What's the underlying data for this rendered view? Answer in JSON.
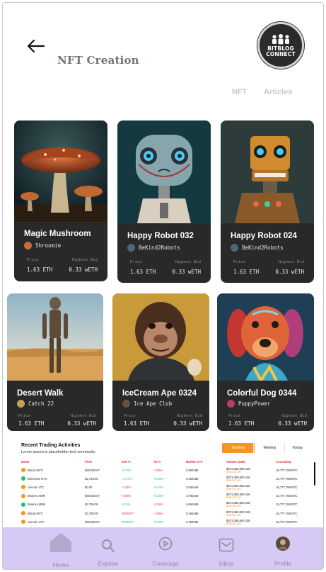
{
  "header": {
    "title": "NFT Creation",
    "logo_line1": "BITBLOG",
    "logo_line2": "CONNECT",
    "tabs": [
      "NFT",
      "Articles"
    ]
  },
  "cards": [
    {
      "title": "Magic Mushroom",
      "creator": "Shroomie",
      "price_label": "Price",
      "bid_label": "Highest Bid",
      "price": "1.63 ETH",
      "bid": "0.33 wETH"
    },
    {
      "title": "Happy Robot 032",
      "creator": "BeKind2Robots",
      "price_label": "Price",
      "bid_label": "Highest Bid",
      "price": "1.63 ETH",
      "bid": "0.33 wETH"
    },
    {
      "title": "Happy Robot 024",
      "creator": "BeKind2Robots",
      "price_label": "Price",
      "bid_label": "Highest Bid",
      "price": "1.63 ETH",
      "bid": "0.33 wETH"
    },
    {
      "title": "Desert Walk",
      "creator": "Catch 22",
      "price_label": "Price",
      "bid_label": "Highest Bid",
      "price": "1.63 ETH",
      "bid": "0.33 wETH"
    },
    {
      "title": "IceCream Ape 0324",
      "creator": "Ice Ape Club",
      "price_label": "Price",
      "bid_label": "Highest Bid",
      "price": "1.63 ETH",
      "bid": "0.33 wETH"
    },
    {
      "title": "Colorful Dog 0344",
      "creator": "PuppyPower",
      "price_label": "Price",
      "bid_label": "Highest Bid",
      "price": "1.63 ETH",
      "bid": "0.33 wETH"
    }
  ],
  "trading": {
    "title": "Recent Trading Activities",
    "subtitle": "Lorem ipsum is placeholder text commonly.",
    "periods": [
      "Monthly",
      "Weekly",
      "Today"
    ],
    "columns": [
      "Name",
      "Price",
      "24H %",
      "7D %",
      "Market CAP",
      "Volume (24H)",
      "Circulating"
    ],
    "rows": [
      {
        "coin": "Bitcoin BTC",
        "price": "$40,500.07",
        "h24": "+0.93%",
        "d7": "-4.55%",
        "cap": "0.854468",
        "vol": "$373,359,590,155",
        "vol2": "$950,520,600",
        "circ": "18,777,768 BTC"
      },
      {
        "coin": "Ethereum ETH",
        "price": "$2,799.00",
        "h24": "+4.47%",
        "d7": "+8.49%",
        "cap": "0.454468",
        "vol": "$373,359,590,155",
        "vol2": "$950,520,600",
        "circ": "18,777,768 BTC"
      },
      {
        "coin": "Litecoin LTC",
        "price": "$0.00",
        "h24": "-3.32%",
        "d7": "+0.04%",
        "cap": "23.65446",
        "vol": "$373,359,590,155",
        "vol2": "$950,520,600",
        "circ": "18,777,768 BTC"
      },
      {
        "coin": "Monero XMR",
        "price": "$40,500.07",
        "h24": "-0.93%",
        "d7": "+4.55%",
        "cap": "17.65446",
        "vol": "$373,359,590,155",
        "vol2": "$950,520,600",
        "circ": "18,777,768 BTC"
      },
      {
        "coin": "Binance BNB",
        "price": "$2,799.00",
        "h24": "+0.0%",
        "d7": "-0.02%",
        "cap": "0.654468",
        "vol": "$373,359,590,155",
        "vol2": "$950,520,600",
        "circ": "18,777,768 BTC"
      },
      {
        "coin": "Bitcoin BTC",
        "price": "$2,799.00",
        "h24": "MARKET",
        "d7": "-4.55%",
        "cap": "0.454468",
        "vol": "$373,359,590,155",
        "vol2": "$950,520,600",
        "circ": "18,777,768 BTC"
      },
      {
        "coin": "Litecoin LTC",
        "price": "$40,500.07",
        "h24": "MARKET",
        "d7": "+8.49%",
        "cap": "0.454468",
        "vol": "$373,359,590,155",
        "vol2": "$950,520,600",
        "circ": "18,777,768 BTC"
      }
    ]
  },
  "nav": [
    "Home",
    "Explore",
    "Coverage",
    "Inbox",
    "Profile"
  ],
  "colors": {
    "card_bg": "#292929",
    "accent": "#f7941d",
    "nav_bg": "#d6c9f5",
    "positive": "#1fbf75",
    "negative": "#e0312c"
  }
}
